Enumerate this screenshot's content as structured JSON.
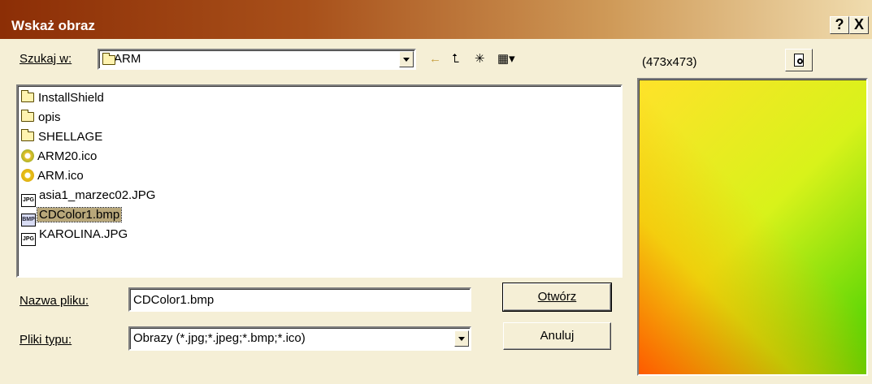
{
  "window": {
    "title": "Wskaż obraz",
    "help_label": "?",
    "close_label": "X"
  },
  "lookin": {
    "label": "Szukaj w:",
    "value": "ARM"
  },
  "toolbar": {
    "back_icon": "←",
    "up_icon": "⮤",
    "newfolder_icon": "✳",
    "view_icon": "▦▾"
  },
  "preview": {
    "size_text": "(473x473)",
    "colors": [
      "#ffe22a",
      "#d8f21a",
      "#3fd000",
      "#ff5a00"
    ]
  },
  "files": [
    {
      "name": "InstallShield",
      "icon": "folder"
    },
    {
      "name": "opis",
      "icon": "folder"
    },
    {
      "name": "SHELLAGE",
      "icon": "folder"
    },
    {
      "name": "ARM20.ico",
      "icon": "ico-icon"
    },
    {
      "name": "ARM.ico",
      "icon": "ico-icon"
    },
    {
      "name": "asia1_marzec02.JPG",
      "icon": "jpg-icon",
      "badge": "JPG"
    },
    {
      "name": "CDColor1.bmp",
      "icon": "bmp-icon",
      "badge": "BMP"
    },
    {
      "name": "KAROLINA.JPG",
      "icon": "jpg-icon",
      "badge": "JPG"
    }
  ],
  "filename": {
    "label": "Nazwa pliku:",
    "value": "CDColor1.bmp"
  },
  "filetype": {
    "label": "Pliki typu:",
    "value": "Obrazy (*.jpg;*.jpeg;*.bmp;*.ico)"
  },
  "buttons": {
    "open": "Otwórz",
    "cancel": "Anuluj"
  }
}
